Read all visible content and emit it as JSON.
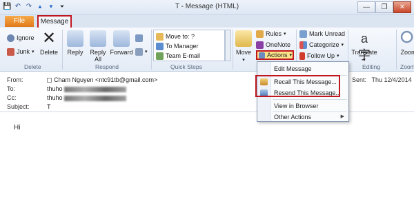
{
  "window": {
    "title": "T - Message (HTML)"
  },
  "qat": {
    "save": "💾",
    "undo": "↶",
    "redo": "↷",
    "up": "▲",
    "down": "▼",
    "more": "⏷"
  },
  "winbtns": {
    "min": "—",
    "max": "❐",
    "close": "✕"
  },
  "tabs": {
    "file": "File",
    "message": "Message"
  },
  "ribbon": {
    "delete": {
      "ignore": "Ignore",
      "junk": "Junk",
      "delete": "Delete",
      "label": "Delete"
    },
    "respond": {
      "reply": "Reply",
      "reply_all_1": "Reply",
      "reply_all_2": "All",
      "forward": "Forward",
      "label": "Respond"
    },
    "quick_steps": {
      "items": [
        "Move to: ?",
        "To Manager",
        "Team E-mail"
      ],
      "label": "Quick Steps"
    },
    "move": {
      "move": "Move",
      "rules": "Rules",
      "onenote": "OneNote",
      "actions": "Actions"
    },
    "tags": {
      "mark_unread": "Mark Unread",
      "categorize": "Categorize",
      "follow_up": "Follow Up"
    },
    "editing": {
      "translate": "Translate",
      "label": "Editing"
    },
    "zoom": {
      "zoom": "Zoom",
      "label": "Zoom"
    }
  },
  "header": {
    "from_label": "From:",
    "from_value": "Cham Nguyen <ntc91tb@gmail.com>",
    "to_label": "To:",
    "to_value": "thuho",
    "cc_label": "Cc:",
    "cc_value": "thuho",
    "subject_label": "Subject:",
    "subject_value": "T",
    "sent_label": "Sent:",
    "sent_value": "Thu 12/4/2014"
  },
  "body": {
    "text": "Hi"
  },
  "actions_menu": {
    "items": [
      "Edit Message",
      "Recall This Message...",
      "Resend This Message...",
      "View in Browser",
      "Other Actions"
    ]
  },
  "colors": {
    "highlight": "#c0171f",
    "file_tab": "#e0791b",
    "ribbon": "#e3ebf6"
  }
}
